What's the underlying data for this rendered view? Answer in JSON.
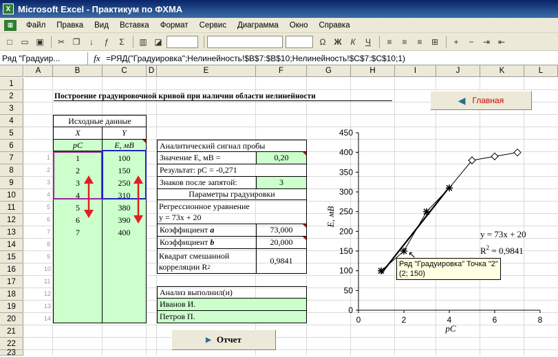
{
  "app": {
    "title": "Microsoft Excel - Практикум по ФХМА"
  },
  "menu": [
    "Файл",
    "Правка",
    "Вид",
    "Вставка",
    "Формат",
    "Сервис",
    "Диаграмма",
    "Окно",
    "Справка"
  ],
  "formula_bar": {
    "name_box": "Ряд \"Градуир...",
    "fx": "fx",
    "formula": "=РЯД(\"Градуировка\";Нелинейность!$B$7:$B$10;Нелинейность!$C$7:$C$10;1)"
  },
  "columns": [
    "A",
    "B",
    "C",
    "D",
    "E",
    "F",
    "G",
    "H",
    "I",
    "J",
    "K",
    "L"
  ],
  "rows": [
    "1",
    "2",
    "3",
    "4",
    "5",
    "6",
    "7",
    "8",
    "9",
    "10",
    "11",
    "12",
    "13",
    "14",
    "15",
    "16",
    "17",
    "18",
    "19",
    "20",
    "21",
    "22",
    "23"
  ],
  "sheet": {
    "title": "Построение градуировочной кривой при наличии области нелинейности",
    "source_header": "Исходные данные",
    "x_label": "X",
    "y_label": "Y",
    "x_unit": "pC",
    "y_unit": "E, мВ",
    "data_x": [
      "1",
      "2",
      "3",
      "4",
      "5",
      "6",
      "7"
    ],
    "data_y": [
      "100",
      "150",
      "250",
      "310",
      "380",
      "390",
      "400"
    ],
    "row_numbers": [
      "1",
      "2",
      "3",
      "4",
      "5",
      "6",
      "7",
      "8",
      "9",
      "10",
      "11",
      "12",
      "13",
      "14"
    ],
    "signal_header": "Аналитический сигнал пробы",
    "signal_value_label": "Значение E, мВ =",
    "signal_value": "0,20",
    "result": "Результат: pC = -0,271",
    "digits_label": "Знаков после запятой:",
    "digits_value": "3",
    "params_header": "Параметры градуировки",
    "regression_label": "Регрессионное уравнение",
    "regression_eq": "y = 73x + 20",
    "coef_a_label": "Коэффициент",
    "coef_a_sym": "a",
    "coef_a_value": "73,000",
    "coef_b_label": "Коэффициент",
    "coef_b_sym": "b",
    "coef_b_value": "20,000",
    "r2_label_1": "Квадрат смешанной",
    "r2_label_2": "корреляции R",
    "r2_label_sup": "2",
    "r2_value": "0,9841",
    "analysis_label": "Анализ выполнил(и)",
    "analyst_1": "Иванов И.",
    "analyst_2": "Петров П."
  },
  "buttons": {
    "main": "Главная",
    "report": "Отчет"
  },
  "tooltip": {
    "line1": "Ряд \"Градуировка\" Точка \"2\"",
    "line2": "(2; 150)"
  },
  "colors": {
    "accent": "#ccffcc",
    "main_button_text": "#cc0000",
    "arrow": "#e02020",
    "selection": "#2020c0"
  },
  "chart_data": {
    "type": "scatter",
    "xlabel": "pC",
    "ylabel": "E, мВ",
    "xlim": [
      0,
      8
    ],
    "ylim": [
      0,
      450
    ],
    "xticks": [
      "0",
      "2",
      "4",
      "6",
      "8"
    ],
    "yticks": [
      "0",
      "50",
      "100",
      "150",
      "200",
      "250",
      "300",
      "350",
      "400",
      "450"
    ],
    "series": [
      {
        "marker": "star",
        "x": [
          1,
          2,
          3,
          4
        ],
        "y": [
          100,
          150,
          250,
          310
        ]
      },
      {
        "marker": "diamond",
        "x": [
          5,
          6,
          7
        ],
        "y": [
          380,
          390,
          400
        ]
      }
    ],
    "connecting_line": {
      "x": [
        1,
        2,
        3,
        4,
        5,
        6,
        7
      ],
      "y": [
        100,
        150,
        250,
        310,
        380,
        390,
        400
      ]
    },
    "trendline": {
      "slope": 73,
      "intercept": 20,
      "x": [
        1,
        4
      ]
    },
    "equation_text": "y = 73x + 20",
    "r2_text_main": "R",
    "r2_text_sup": "2",
    "r2_text_value": " = 0,9841"
  }
}
